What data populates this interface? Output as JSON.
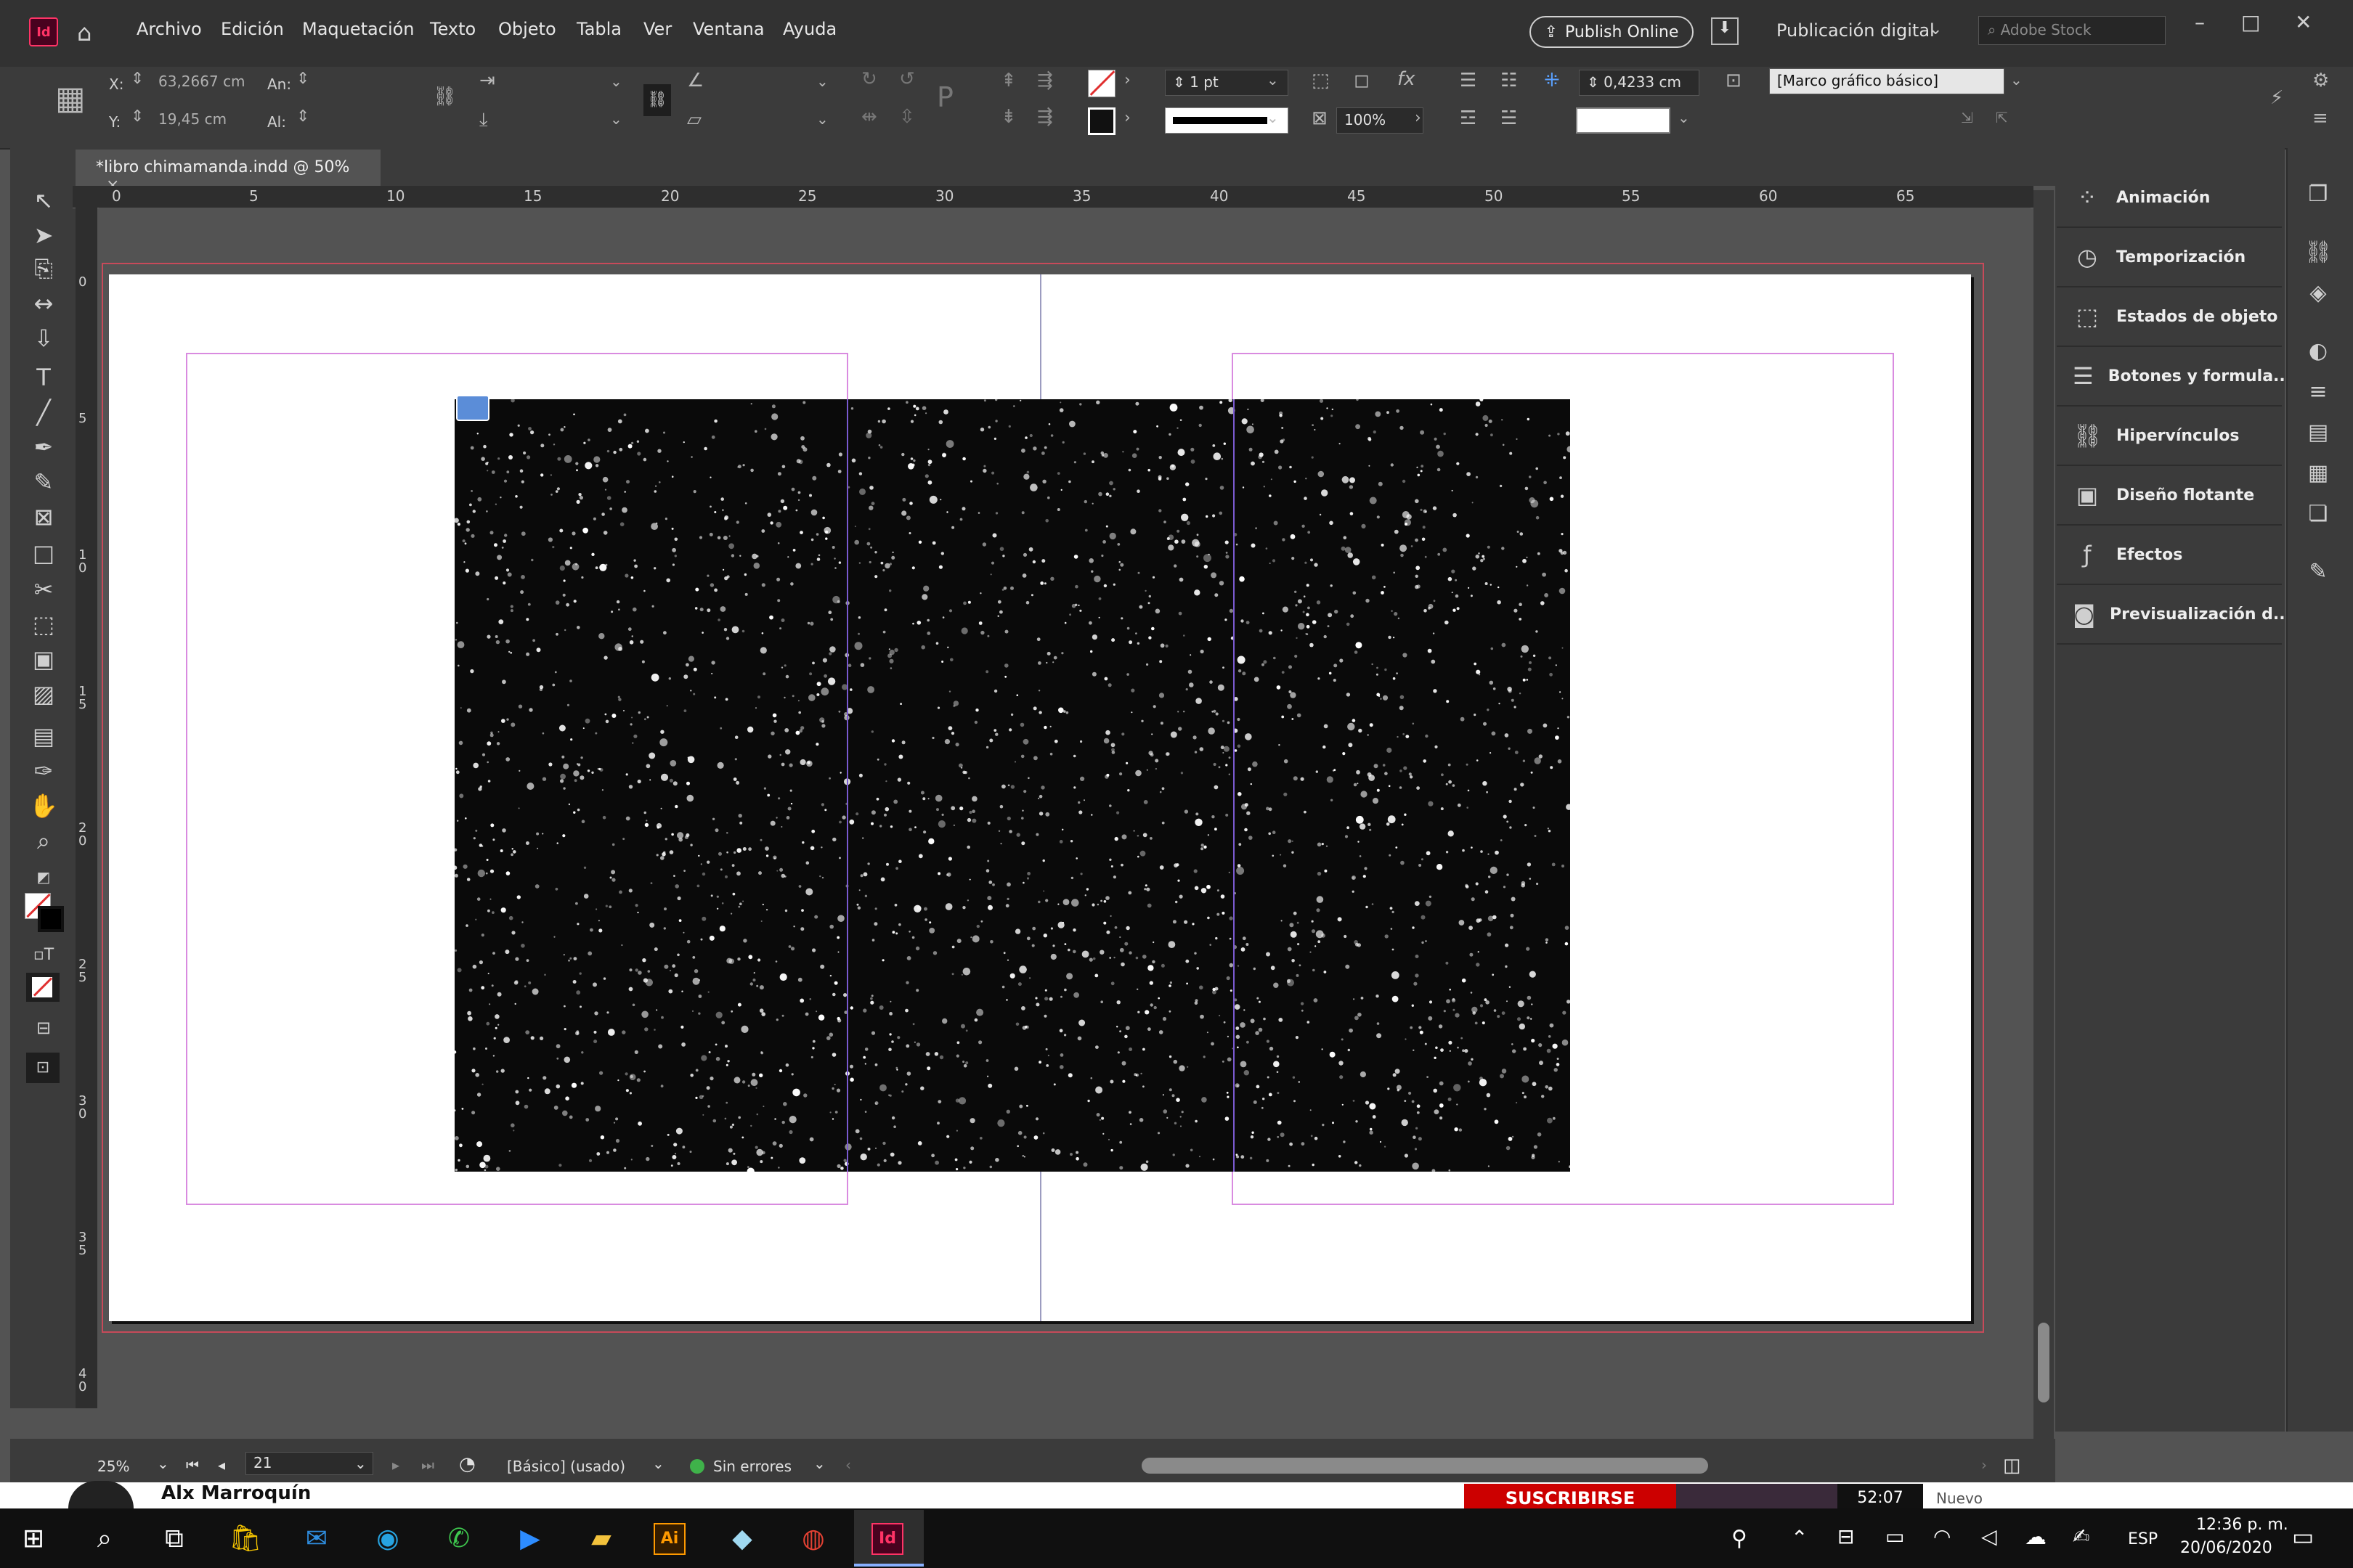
{
  "app": {
    "logo": "Id",
    "workspace": "Publicación digital",
    "stock_placeholder": "Adobe Stock",
    "publish_label": "Publish Online"
  },
  "menu": [
    "Archivo",
    "Edición",
    "Maquetación",
    "Texto",
    "Objeto",
    "Tabla",
    "Ver",
    "Ventana",
    "Ayuda"
  ],
  "control": {
    "x_label": "X:",
    "x_value": "63,2667 cm",
    "y_label": "Y:",
    "y_value": "19,45 cm",
    "w_label": "An:",
    "h_label": "Al:",
    "stroke_weight": "1 pt",
    "scale": "100%",
    "offset": "0,4233 cm",
    "object_style": "[Marco gráfico básico]"
  },
  "document": {
    "tab_title": "*libro chimamanda.indd @ 50%"
  },
  "ruler_h": [
    "0",
    "5",
    "10",
    "15",
    "20",
    "25",
    "30",
    "35",
    "40",
    "45",
    "50",
    "55",
    "60",
    "65"
  ],
  "ruler_v": [
    "0",
    "5",
    "10",
    "15",
    "20",
    "25",
    "30",
    "35",
    "40"
  ],
  "panels": [
    {
      "label": "Animación",
      "icon": "animation-icon"
    },
    {
      "label": "Temporización",
      "icon": "timing-icon"
    },
    {
      "label": "Estados de objeto",
      "icon": "object-states-icon"
    },
    {
      "label": "Botones y formula...",
      "icon": "buttons-forms-icon"
    },
    {
      "label": "Hipervínculos",
      "icon": "hyperlinks-icon"
    },
    {
      "label": "Diseño flotante",
      "icon": "liquid-layout-icon"
    },
    {
      "label": "Efectos",
      "icon": "effects-icon"
    },
    {
      "label": "Previsualización d...",
      "icon": "preview-icon"
    }
  ],
  "status": {
    "zoom": "25%",
    "page": "21",
    "style": "[Básico] (usado)",
    "errors": "Sin errores"
  },
  "background_web": {
    "channel": "Alx Marroquín",
    "subscribe": "SUSCRIBIRSE",
    "duration": "52:07",
    "new_label": "Nuevo"
  },
  "taskbar": {
    "lang": "ESP",
    "time": "12:36 p. m.",
    "date": "20/06/2020"
  },
  "colors": {
    "accent_id": "#ff3366",
    "panel": "#3b3b3b",
    "pasteboard": "#535353",
    "margin": "#d98be0",
    "bleed": "#c74a5a"
  }
}
